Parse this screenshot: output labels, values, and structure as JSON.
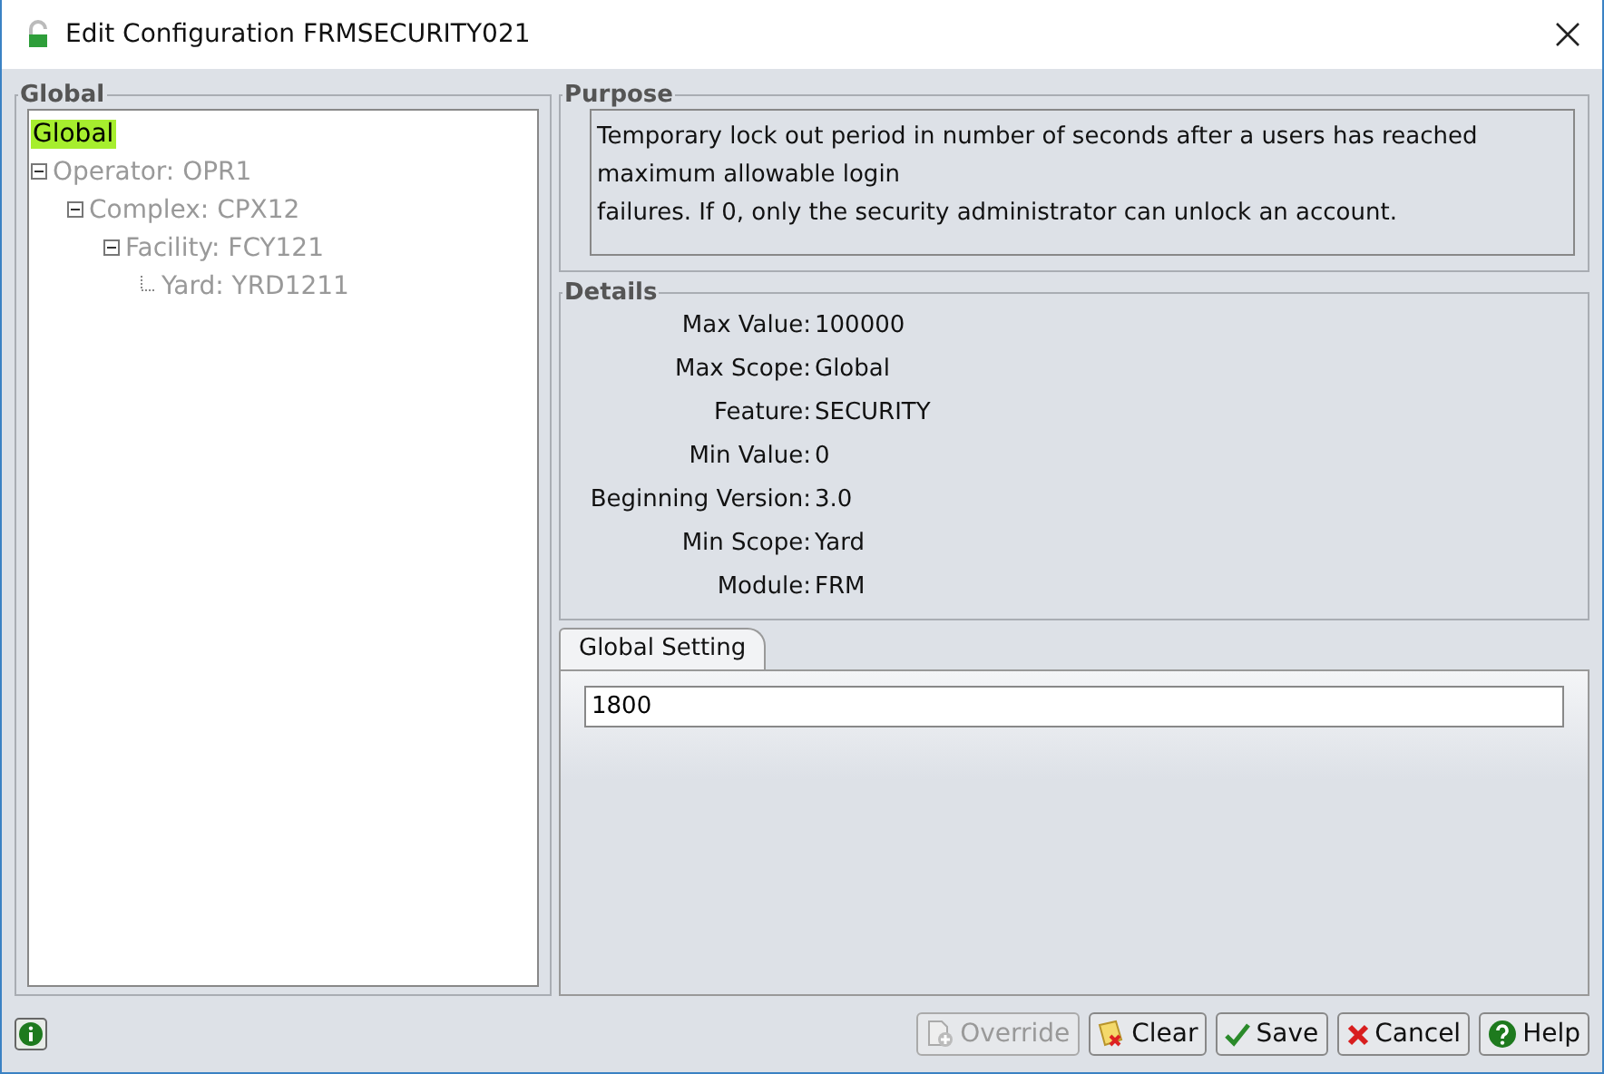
{
  "window": {
    "title": "Edit Configuration FRMSECURITY021"
  },
  "tree": {
    "title": "Global",
    "nodes": [
      {
        "label": "Global",
        "selected": true,
        "disabled": false,
        "children": [
          {
            "label": "Operator: OPR1",
            "selected": false,
            "disabled": true,
            "children": [
              {
                "label": "Complex: CPX12",
                "selected": false,
                "disabled": true,
                "children": [
                  {
                    "label": "Facility: FCY121",
                    "selected": false,
                    "disabled": true,
                    "children": [
                      {
                        "label": "Yard: YRD1211",
                        "selected": false,
                        "disabled": true
                      }
                    ]
                  }
                ]
              }
            ]
          }
        ]
      }
    ]
  },
  "purpose": {
    "title": "Purpose",
    "lines": [
      "Temporary lock out period in number of seconds after a users has reached maximum allowable login",
      "failures. If 0, only the security administrator can unlock an account."
    ]
  },
  "details": {
    "title": "Details",
    "rows": [
      {
        "label": "Max Value:",
        "value": "100000"
      },
      {
        "label": "Max Scope:",
        "value": "Global"
      },
      {
        "label": "Feature:",
        "value": "SECURITY"
      },
      {
        "label": "Min Value:",
        "value": "0"
      },
      {
        "label": "Beginning Version:",
        "value": "3.0"
      },
      {
        "label": "Min Scope:",
        "value": "Yard"
      },
      {
        "label": "Module:",
        "value": "FRM"
      }
    ]
  },
  "tabs": [
    {
      "label": "Global Setting",
      "selected": true
    }
  ],
  "setting": {
    "value": "1800"
  },
  "buttons": [
    {
      "kind": "override",
      "label": "Override",
      "disabled": true
    },
    {
      "kind": "clear",
      "label": "Clear",
      "disabled": false
    },
    {
      "kind": "save",
      "label": "Save",
      "disabled": false
    },
    {
      "kind": "cancel",
      "label": "Cancel",
      "disabled": false
    },
    {
      "kind": "help",
      "label": "Help",
      "disabled": false
    }
  ]
}
